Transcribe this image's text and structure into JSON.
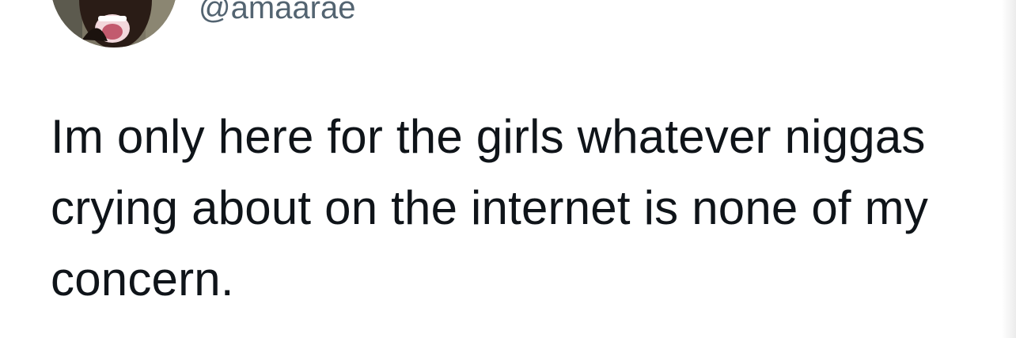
{
  "author": {
    "handle": "@amaarae",
    "avatar_icon": "profile-avatar"
  },
  "tweet": {
    "text": "Im only here for the girls whatever niggas crying about on the internet is none of my concern."
  },
  "colors": {
    "background": "#ffffff",
    "text": "#0f1419",
    "secondary_text": "#536471"
  }
}
